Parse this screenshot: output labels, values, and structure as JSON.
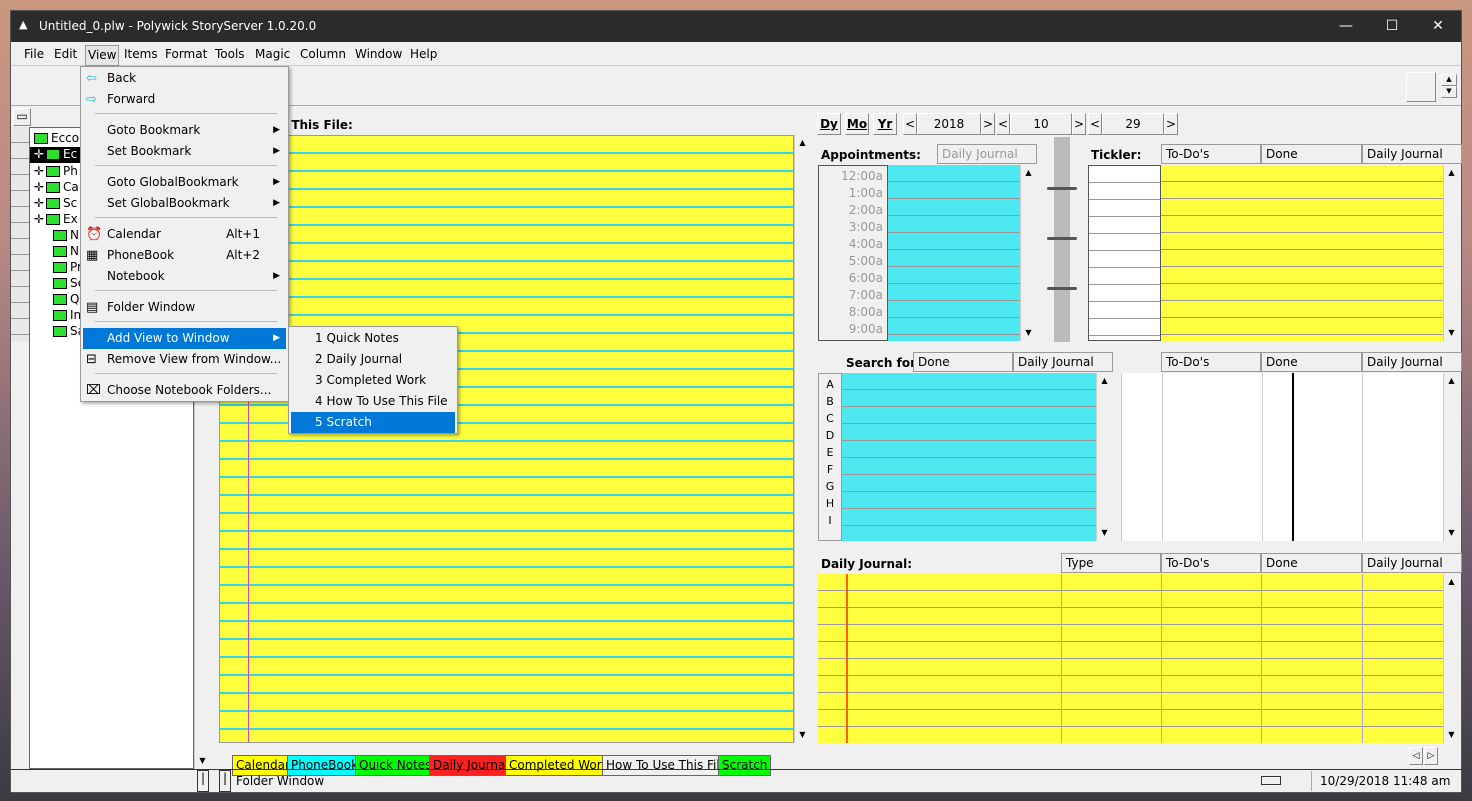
{
  "window": {
    "title": "Untitled_0.plw - Polywick StoryServer 1.0.20.0",
    "minimize": "—",
    "maximize": "☐",
    "close": "✕"
  },
  "menubar": [
    "File",
    "Edit",
    "View",
    "Items",
    "Format",
    "Tools",
    "Magic",
    "Column",
    "Window",
    "Help"
  ],
  "tree": {
    "root": "Ecco",
    "items": [
      "Ec",
      "Ph",
      "Ca",
      "Sc",
      "Ex",
      "N",
      "N",
      "Pr",
      "Se",
      "Q",
      "In",
      "Sa"
    ]
  },
  "view_menu": {
    "items": [
      {
        "label": "Back",
        "icon": "arrow-left-icon"
      },
      {
        "label": "Forward",
        "icon": "arrow-right-icon"
      },
      {
        "label": "Goto Bookmark",
        "submenu": true
      },
      {
        "label": "Set Bookmark",
        "submenu": true
      },
      {
        "label": "Goto GlobalBookmark",
        "submenu": true
      },
      {
        "label": "Set GlobalBookmark",
        "submenu": true
      },
      {
        "label": "Calendar",
        "shortcut": "Alt+1",
        "icon": "calendar-icon"
      },
      {
        "label": "PhoneBook",
        "shortcut": "Alt+2",
        "icon": "phonebook-icon"
      },
      {
        "label": "Notebook",
        "submenu": true
      },
      {
        "label": "Folder Window",
        "icon": "folder-window-icon"
      },
      {
        "label": "Add View to Window",
        "submenu": true,
        "highlighted": true
      },
      {
        "label": "Remove View from Window...",
        "icon": "remove-view-icon"
      },
      {
        "label": "Choose Notebook Folders...",
        "icon": "choose-folders-icon"
      }
    ]
  },
  "add_view_submenu": [
    "1 Quick Notes",
    "2 Daily Journal",
    "3 Completed Work",
    "4 How To Use This File",
    "5 Scratch"
  ],
  "add_view_selected": "5 Scratch",
  "notebook": {
    "title": "e This File:"
  },
  "calendar_nav": {
    "dy": "Dy",
    "mo": "Mo",
    "yr": "Yr",
    "year": "2018",
    "month": "10",
    "day": "29",
    "prev": "<",
    "next": ">"
  },
  "appointments": {
    "title": "Appointments:",
    "col": "Daily Journal",
    "times": [
      "12:00a",
      "1:00a",
      "2:00a",
      "3:00a",
      "4:00a",
      "5:00a",
      "6:00a",
      "7:00a",
      "8:00a",
      "9:00a"
    ]
  },
  "tickler": {
    "title": "Tickler:",
    "cols": [
      "To-Do's",
      "Done",
      "Daily Journal"
    ]
  },
  "search": {
    "title": "Search for:",
    "cols": [
      "Done",
      "Daily Journal"
    ],
    "letters": [
      "A",
      "B",
      "C",
      "D",
      "E",
      "F",
      "G",
      "H",
      "I"
    ]
  },
  "mid_right": {
    "cols": [
      "To-Do's",
      "Done",
      "Daily Journal"
    ]
  },
  "daily_journal": {
    "title": "Daily Journal:",
    "cols": [
      "Type",
      "To-Do's",
      "Done",
      "Daily Journal"
    ]
  },
  "tabs": [
    {
      "label": "Calendar",
      "color": "#ffff00"
    },
    {
      "label": "PhoneBook",
      "color": "#00ffff"
    },
    {
      "label": "Quick Notes",
      "color": "#00ff00"
    },
    {
      "label": "Daily Journal",
      "color": "#ff2020"
    },
    {
      "label": "Completed Work",
      "color": "#ffff00"
    },
    {
      "label": "How To Use This File",
      "color": "#f0f0f0"
    },
    {
      "label": "Scratch",
      "color": "#00ff00"
    }
  ],
  "status": {
    "text": "Folder Window",
    "datetime": "10/29/2018 11:48 am"
  }
}
